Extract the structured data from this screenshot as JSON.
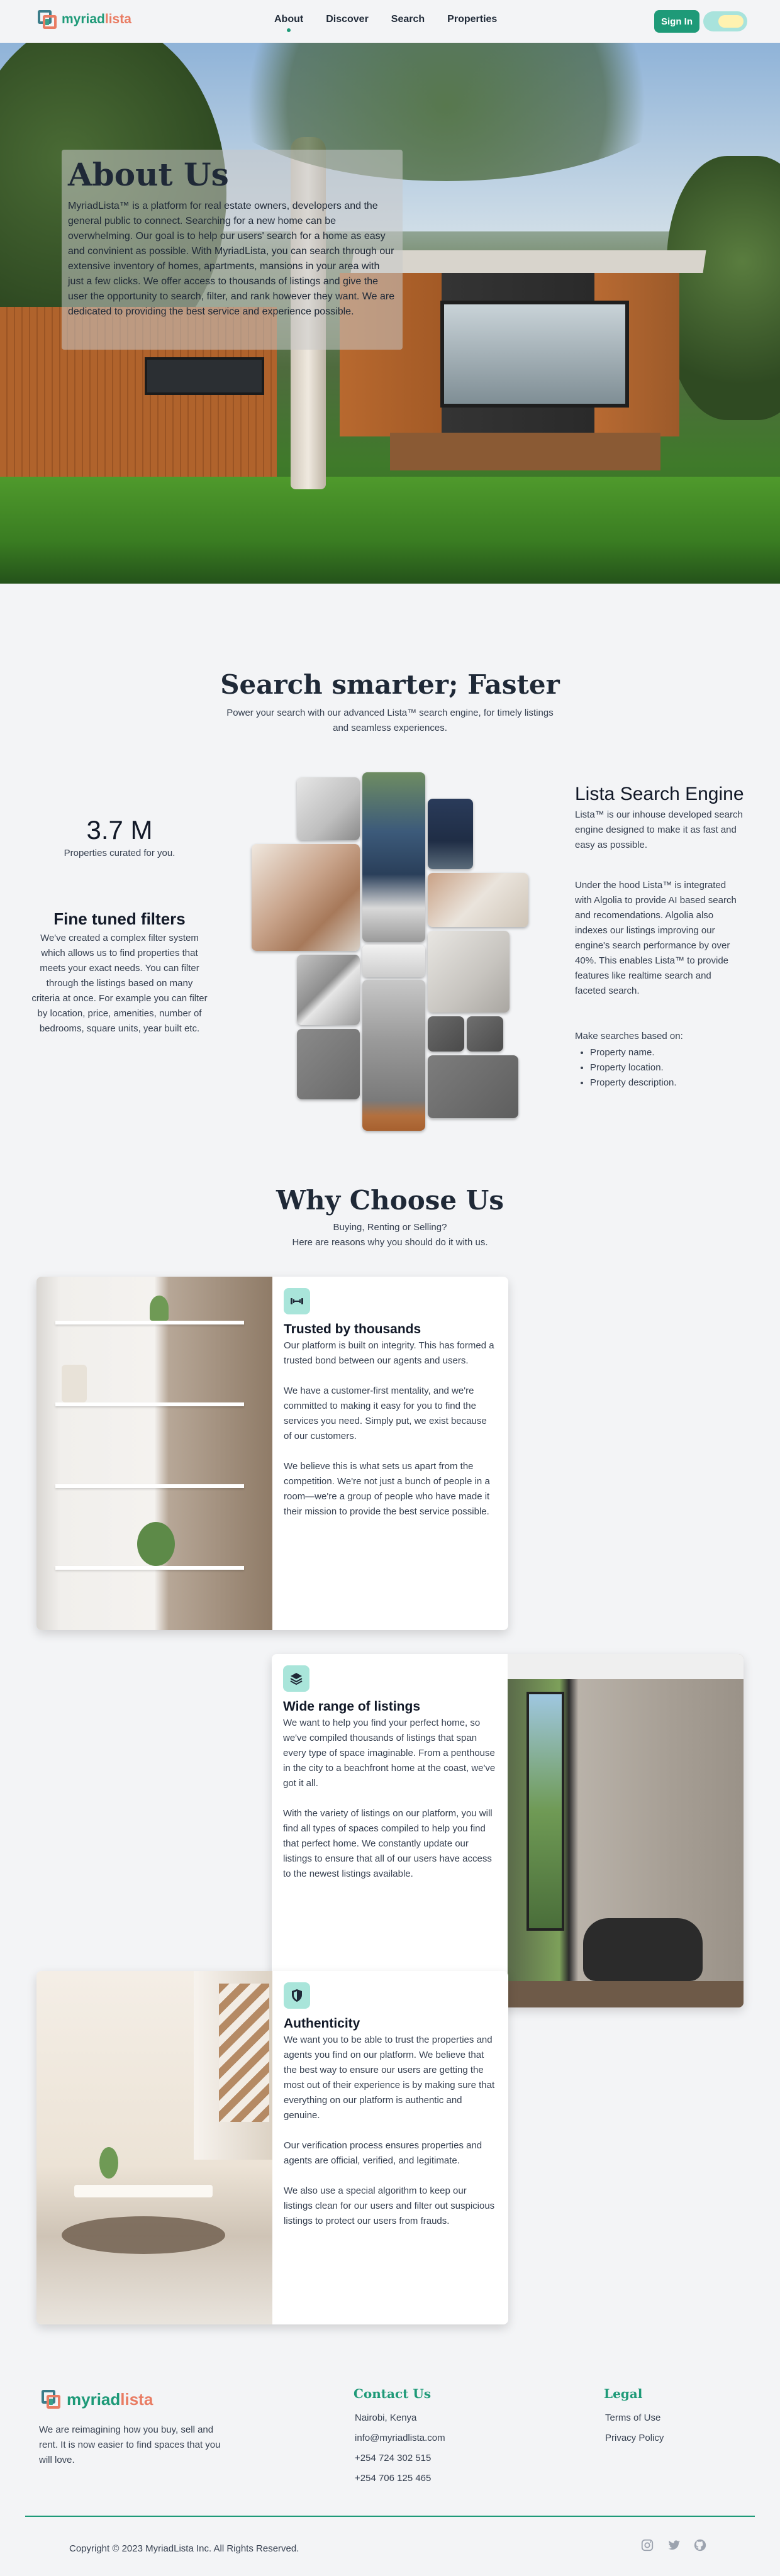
{
  "nav": {
    "logo_part1": "myriad",
    "logo_part2": "lista",
    "links": [
      "About",
      "Discover",
      "Search",
      "Properties"
    ],
    "signin_label": "Sign In"
  },
  "hero": {
    "title": "About Us",
    "text": "MyriadLista™ is a platform for real estate owners, developers and the general public to connect. Searching for a new home can be overwhelming. Our goal is to help our users' search for a home as easy and convinient as possible. With MyriadLista, you can search through our extensive inventory of homes, apartments, mansions in your area with just a few clicks. We offer access to thousands of listings and give the user the opportunity to search, filter, and rank however they want. We are dedicated to providing the best service and experience possible."
  },
  "search": {
    "title": "Search smarter; Faster",
    "subtitle": "Power your search with our advanced Lista™ search engine, for timely listings and seamless experiences.",
    "stat_number": "3.7 M",
    "stat_label": "Properties curated for you.",
    "filters_title": "Fine tuned filters",
    "filters_text": "We've created a complex filter system which allows us to find properties that meets your exact needs. You can filter through the listings based on many criteria at once. For example you can filter by location, price, amenities, number of bedrooms, square units, year built etc.",
    "engine_title": "Lista Search Engine",
    "engine_p1": "Lista™ is our inhouse developed search engine designed to make it as fast and easy as possible.",
    "engine_p2": "Under the hood Lista™ is integrated with Algolia to provide AI based search and recomendations. Algolia also indexes our listings improving our engine's search performance by over 40%. This enables Lista™ to provide features like realtime search and faceted search.",
    "engine_p3": "Make searches based on:",
    "engine_list": [
      "Property name.",
      "Property location.",
      "Property description."
    ]
  },
  "why": {
    "title": "Why Choose Us",
    "subtitle_1": "Buying, Renting or Selling?",
    "subtitle_2": "Here are reasons why you should do it with us.",
    "cards": [
      {
        "icon": "dumbbell-icon",
        "title": "Trusted by thousands",
        "paragraphs": [
          "Our platform is built on integrity. This has formed a trusted bond between our agents and users.",
          "We have a customer-first mentality, and we're committed to making it easy for you to find the services you need. Simply put, we exist because of our customers.",
          "We believe this is what sets us apart from the competition. We're not just a bunch of people in a room—we're a group of people who have made it their mission to provide the best service possible."
        ]
      },
      {
        "icon": "layers-icon",
        "title": "Wide range of listings",
        "paragraphs": [
          "We want to help you find your perfect home, so we've compiled thousands of listings that span every type of space imaginable. From a penthouse in the city to a beachfront home at the coast, we've got it all.",
          "With the variety of listings on our platform, you will find all types of spaces compiled to help you find that perfect home. We constantly update our listings to ensure that all of our users have access to the newest listings available."
        ]
      },
      {
        "icon": "shield-icon",
        "title": "Authenticity",
        "paragraphs": [
          "We want you to be able to trust the properties and agents you find on our platform. We believe that the best way to ensure our users are getting the most out of their experience is by making sure that everything on our platform is authentic and genuine.",
          "Our verification process ensures properties and agents are official, verified, and legitimate.",
          "We also use a special algorithm to keep our listings clean for our users and filter out suspicious listings to protect our users from frauds."
        ]
      }
    ]
  },
  "footer": {
    "description": "We are reimagining how you buy, sell and rent. It is now easier to find spaces that you will love.",
    "contact_title": "Contact Us",
    "contact_items": [
      "Nairobi, Kenya",
      "info@myriadlista.com",
      "+254 724 302 515",
      "+254 706 125 465"
    ],
    "legal_title": "Legal",
    "legal_items": [
      "Terms of Use",
      "Privacy Policy"
    ],
    "copyright": "Copyright © 2023 MyriadLista Inc. All Rights Reserved.",
    "social": [
      "instagram-icon",
      "twitter-icon",
      "github-icon"
    ]
  },
  "colors": {
    "brand_green": "#1e9a78",
    "brand_coral": "#e97c63",
    "icon_bg": "#a9e5da",
    "page_bg": "#f3f4f6"
  }
}
